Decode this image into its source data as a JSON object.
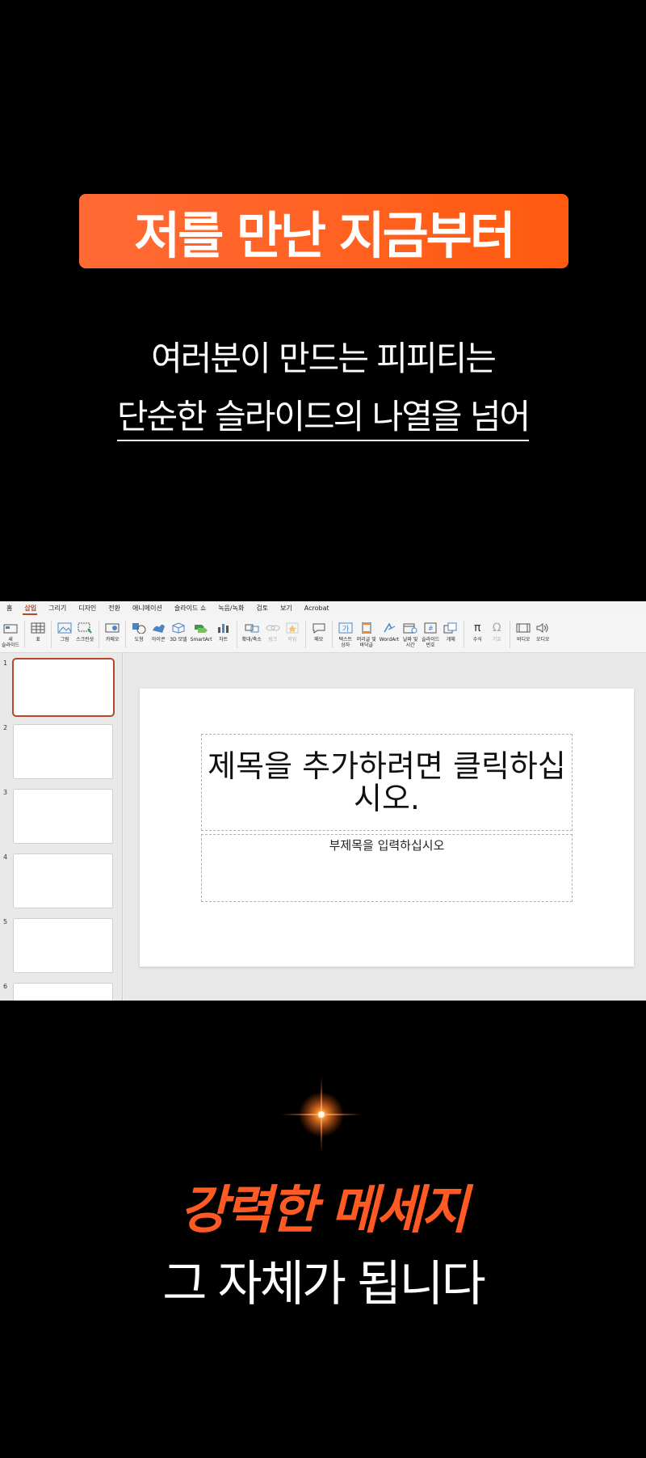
{
  "banner": {
    "text": "저를 만난 지금부터"
  },
  "intro": {
    "line1": "여러분이 만드는 피피티는",
    "line2": "단순한 슬라이드의 나열을 넘어"
  },
  "ppt": {
    "tabs": [
      {
        "label": "홈"
      },
      {
        "label": "삽입",
        "active": true
      },
      {
        "label": "그리기"
      },
      {
        "label": "디자인"
      },
      {
        "label": "전환"
      },
      {
        "label": "애니메이션"
      },
      {
        "label": "슬라이드 쇼"
      },
      {
        "label": "녹음/녹화"
      },
      {
        "label": "검토"
      },
      {
        "label": "보기"
      },
      {
        "label": "Acrobat"
      }
    ],
    "ribbon": {
      "new_slide": "새\n슬라이드",
      "table": "표",
      "picture": "그림",
      "screenshot": "스크린샷",
      "cameo": "카메오",
      "shapes": "도형",
      "icons": "아이콘",
      "model3d": "3D 모델",
      "smartart": "SmartArt",
      "chart": "차트",
      "zoom": "확대/축소",
      "link": "링크",
      "action": "작업",
      "comment": "메모",
      "textbox": "텍스트\n상자",
      "header_footer": "머리글 및\n바닥글",
      "wordart": "WordArt",
      "datetime": "날짜 및\n시간",
      "slide_number": "슬라이드\n번호",
      "object": "개체",
      "equation": "수식",
      "symbol": "기호",
      "video": "비디오",
      "audio": "오디오"
    },
    "slide_numbers": [
      "1",
      "2",
      "3",
      "4",
      "5",
      "6"
    ],
    "slide": {
      "title_placeholder": "제목을 추가하려면 클릭하십시오.",
      "subtitle_placeholder": "부제목을 입력하십시오"
    },
    "accent_color": "#b7472a"
  },
  "closing": {
    "strong": "강력한 메세지",
    "line": "그 자체가 됩니다"
  },
  "colors": {
    "orange": "#ff5a24",
    "background": "#000000"
  }
}
